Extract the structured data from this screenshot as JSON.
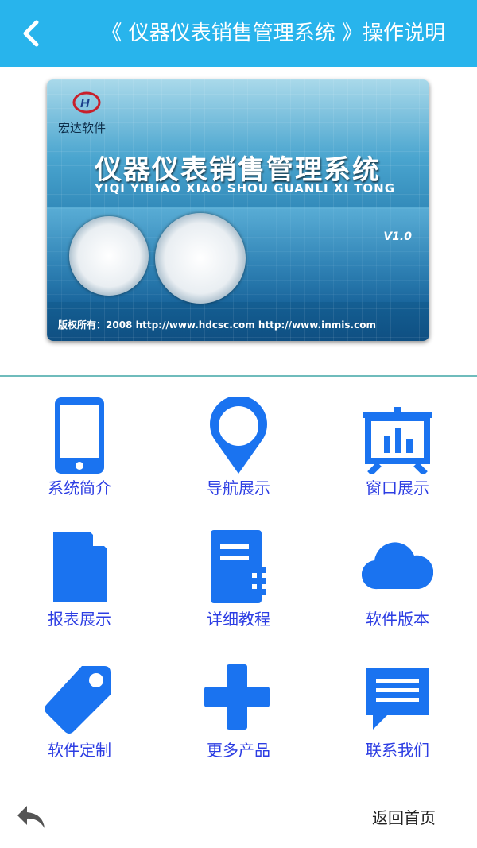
{
  "header": {
    "title": "《 仪器仪表销售管理系统 》操作说明",
    "back_icon": "chevron-left-icon",
    "background_color": "#28b4ec"
  },
  "banner": {
    "company": "宏达软件",
    "title": "仪器仪表销售管理系统",
    "pinyin": "YIQI YIBIAO XIAO SHOU GUANLI XI TONG",
    "version": "V1.0",
    "copyright": "版权所有：2008  http://www.hdcsc.com      http://www.inmis.com"
  },
  "menu": [
    {
      "label": "系统简介",
      "icon": "phone-icon"
    },
    {
      "label": "导航展示",
      "icon": "map-pin-icon"
    },
    {
      "label": "窗口展示",
      "icon": "presentation-chart-icon"
    },
    {
      "label": "报表展示",
      "icon": "document-icon"
    },
    {
      "label": "详细教程",
      "icon": "notebook-icon"
    },
    {
      "label": "软件版本",
      "icon": "cloud-icon"
    },
    {
      "label": "软件定制",
      "icon": "tag-icon"
    },
    {
      "label": "更多产品",
      "icon": "plus-icon"
    },
    {
      "label": "联系我们",
      "icon": "message-icon"
    }
  ],
  "footer": {
    "back_icon": "reply-arrow-icon",
    "home_label": "返回首页"
  },
  "colors": {
    "icon_blue": "#1a73f0",
    "label_blue": "#2c3de3",
    "divider": "#6fbcbc"
  }
}
